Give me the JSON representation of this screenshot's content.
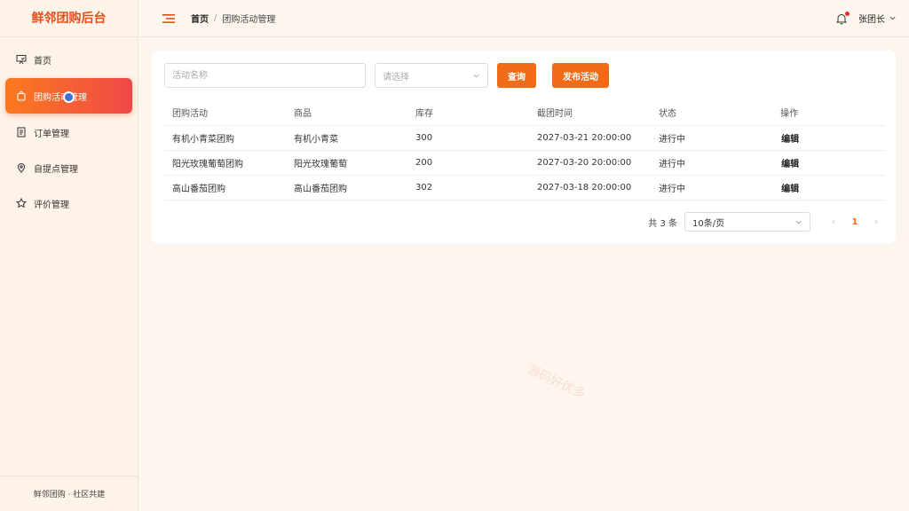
{
  "sidebar": {
    "brand": "鲜邻团购后台",
    "items": [
      {
        "label": "首页",
        "icon": "presentation-icon",
        "active": false
      },
      {
        "label": "团购活动管理",
        "icon": "shopping-bag-icon",
        "active": true
      },
      {
        "label": "订单管理",
        "icon": "document-list-icon",
        "active": false
      },
      {
        "label": "自提点管理",
        "icon": "location-pin-icon",
        "active": false
      },
      {
        "label": "评价管理",
        "icon": "star-icon",
        "active": false
      }
    ],
    "footer": "鲜邻团购 · 社区共建"
  },
  "header": {
    "breadcrumb_home": "首页",
    "breadcrumb_sep": "/",
    "breadcrumb_current": "团购活动管理",
    "user_name": "张团长"
  },
  "filters": {
    "name_placeholder": "活动名称",
    "status_placeholder": "请选择",
    "query_label": "查询",
    "publish_label": "发布活动"
  },
  "table": {
    "columns": [
      "团购活动",
      "商品",
      "库存",
      "截团时间",
      "状态",
      "操作"
    ],
    "rows": [
      {
        "activity": "有机小青菜团购",
        "product": "有机小青菜",
        "stock": "300",
        "deadline": "2027-03-21 20:00:00",
        "status": "进行中",
        "action": "编辑"
      },
      {
        "activity": "阳光玫瑰葡萄团购",
        "product": "阳光玫瑰葡萄",
        "stock": "200",
        "deadline": "2027-03-20 20:00:00",
        "status": "进行中",
        "action": "编辑"
      },
      {
        "activity": "高山番茄团购",
        "product": "高山番茄团购",
        "stock": "302",
        "deadline": "2027-03-18 20:00:00",
        "status": "进行中",
        "action": "编辑"
      }
    ]
  },
  "pagination": {
    "total_text": "共 3 条",
    "page_size": "10条/页",
    "current_page": "1",
    "prev": "‹",
    "next": "›"
  },
  "watermark": "源码好优多",
  "colors": {
    "accent": "#f26b17",
    "brand": "#e2511c",
    "sidebar_active_start": "#fb7a1e",
    "sidebar_active_end": "#f04848"
  }
}
